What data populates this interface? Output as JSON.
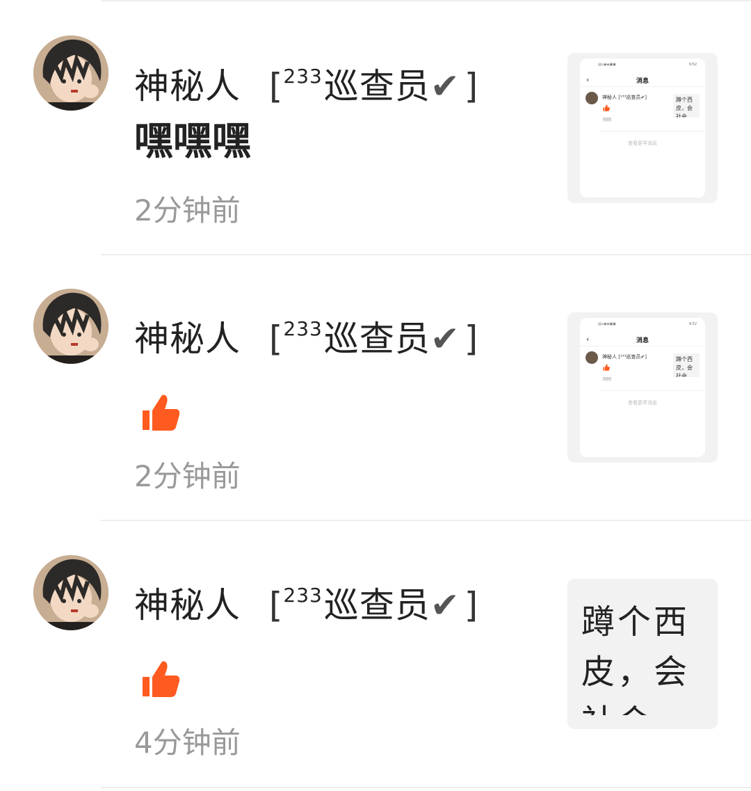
{
  "colors": {
    "accent_like": "#ff5a1f",
    "text_primary": "#222222",
    "text_secondary": "#999999",
    "divider": "#eeeeee",
    "thumb_bg": "#f2f2f2"
  },
  "items": [
    {
      "name": "神秘人",
      "bracket_open": "[",
      "badge_sup": "233",
      "badge_title": "巡查员",
      "badge_tick": "✔",
      "bracket_close": "]",
      "content_text": "嘿嘿嘿",
      "content_icon": null,
      "time": "2分钟前",
      "preview": {
        "type": "screenshot",
        "status_right": "9:52",
        "nav_title": "消息",
        "mini_name": "神秘人 [²³³巡查员✔]",
        "mini_time": "刚刚",
        "mini_text": "蹲个西皮，会社会",
        "more": "查看更早消息"
      }
    },
    {
      "name": "神秘人",
      "bracket_open": "[",
      "badge_sup": "233",
      "badge_title": "巡查员",
      "badge_tick": "✔",
      "bracket_close": "]",
      "content_text": null,
      "content_icon": "thumbs-up-icon",
      "time": "2分钟前",
      "preview": {
        "type": "screenshot",
        "status_right": "9:52",
        "nav_title": "消息",
        "mini_name": "神秘人 [²³³巡查员✔]",
        "mini_time": "刚刚",
        "mini_text": "蹲个西皮，会社会",
        "more": "查看更早消息"
      }
    },
    {
      "name": "神秘人",
      "bracket_open": "[",
      "badge_sup": "233",
      "badge_title": "巡查员",
      "badge_tick": "✔",
      "bracket_close": "]",
      "content_text": null,
      "content_icon": "thumbs-up-icon",
      "time": "4分钟前",
      "preview": {
        "type": "text",
        "text": "蹲个西皮，会社会"
      }
    }
  ]
}
